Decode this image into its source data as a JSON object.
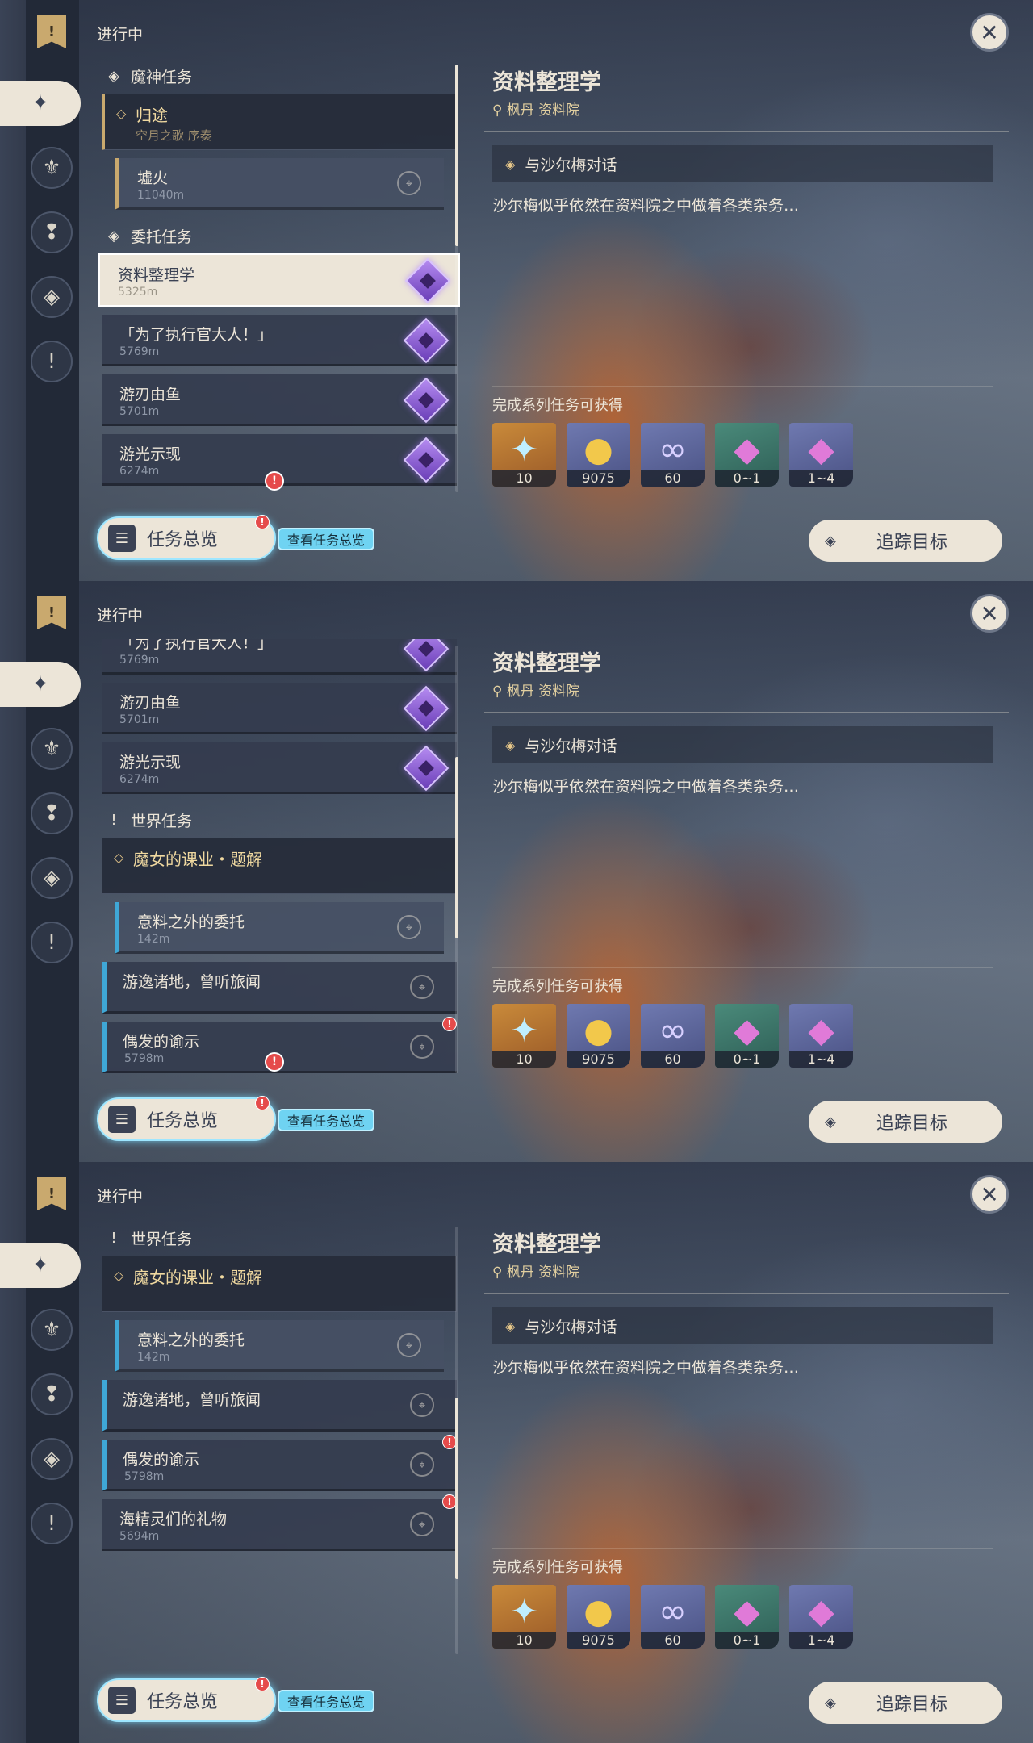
{
  "header": {
    "label": "进行中"
  },
  "sidebar_icons": [
    "bookmark-icon",
    "archon-quest-icon",
    "story-quest-icon",
    "world-quest-icon",
    "commission-icon",
    "exclamation-icon"
  ],
  "sections": {
    "archon": "魔神任务",
    "commission": "委托任务",
    "world": "世界任务"
  },
  "quests": {
    "homeward": {
      "title": "归途",
      "subtitle": "空月之歌 序奏"
    },
    "ember": {
      "title": "墟火",
      "distance": "11040m"
    },
    "study": {
      "title": "资料整理学",
      "distance": "5325m"
    },
    "officer": {
      "title": "「为了执行官大人！」",
      "distance": "5769m"
    },
    "fish": {
      "title": "游刃由鱼",
      "distance": "5701m"
    },
    "light": {
      "title": "游光示现",
      "distance": "6274m"
    },
    "witch": {
      "title": "魔女的课业・题解"
    },
    "unexpected": {
      "title": "意料之外的委托",
      "distance": "142m"
    },
    "wander": {
      "title": "游逸诸地，曾听旅闻"
    },
    "omen": {
      "title": "偶发的谕示",
      "distance": "5798m"
    },
    "oceanid": {
      "title": "海精灵们的礼物",
      "distance": "5694m"
    }
  },
  "overview": {
    "label": "任务总览",
    "tooltip": "查看任务总览",
    "alert": "!"
  },
  "detail": {
    "title": "资料整理学",
    "location": "枫丹 资料院",
    "objective": "与沙尔梅对话",
    "description": "沙尔梅似乎依然在资料院之中做着各类杂务…",
    "rewards_label": "完成系列任务可获得",
    "rewards": [
      {
        "name": "primogem-icon",
        "count": "10"
      },
      {
        "name": "mora-icon",
        "count": "9075"
      },
      {
        "name": "friendship-exp-icon",
        "count": "60"
      },
      {
        "name": "crystal-chunk-icon",
        "count": "0~1"
      },
      {
        "name": "crystal-cluster-icon",
        "count": "1~4"
      }
    ],
    "track_label": "追踪目标",
    "close": "✕"
  },
  "colors": {
    "accent_gold": "#c9a96e",
    "panel_bg": "#2e3646",
    "cream": "#ece5d8",
    "alert_red": "#e54b4b",
    "world_blue": "#3fa7d6"
  },
  "frames": [
    {
      "scroll_thumb_fraction_top": 0.0,
      "scroll_thumb_fraction_size": 0.42
    },
    {
      "scroll_thumb_fraction_top": 0.26,
      "scroll_thumb_fraction_size": 0.42
    },
    {
      "scroll_thumb_fraction_top": 0.4,
      "scroll_thumb_fraction_size": 0.42
    }
  ]
}
